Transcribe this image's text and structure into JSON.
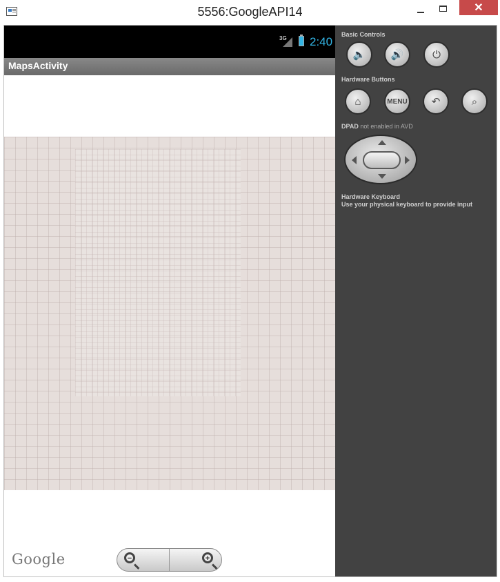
{
  "window": {
    "title": "5556:GoogleAPI14",
    "close_glyph": "✕"
  },
  "statusbar": {
    "network": "3G",
    "time": "2:40"
  },
  "app": {
    "title": "MapsActivity"
  },
  "map": {
    "logo": "Google",
    "zoom_out_symbol": "−",
    "zoom_in_symbol": "+"
  },
  "panel": {
    "basic_controls_label": "Basic Controls",
    "hardware_buttons_label": "Hardware Buttons",
    "menu_label": "MENU",
    "dpad_label": "DPAD",
    "dpad_note": "not enabled in AVD",
    "keyboard_title": "Hardware Keyboard",
    "keyboard_note": "Use your physical keyboard to provide input"
  },
  "colors": {
    "accent": "#33b5e5",
    "panel_bg": "#424242",
    "map_bg": "#e6dedb",
    "close_button": "#c74a4a"
  }
}
